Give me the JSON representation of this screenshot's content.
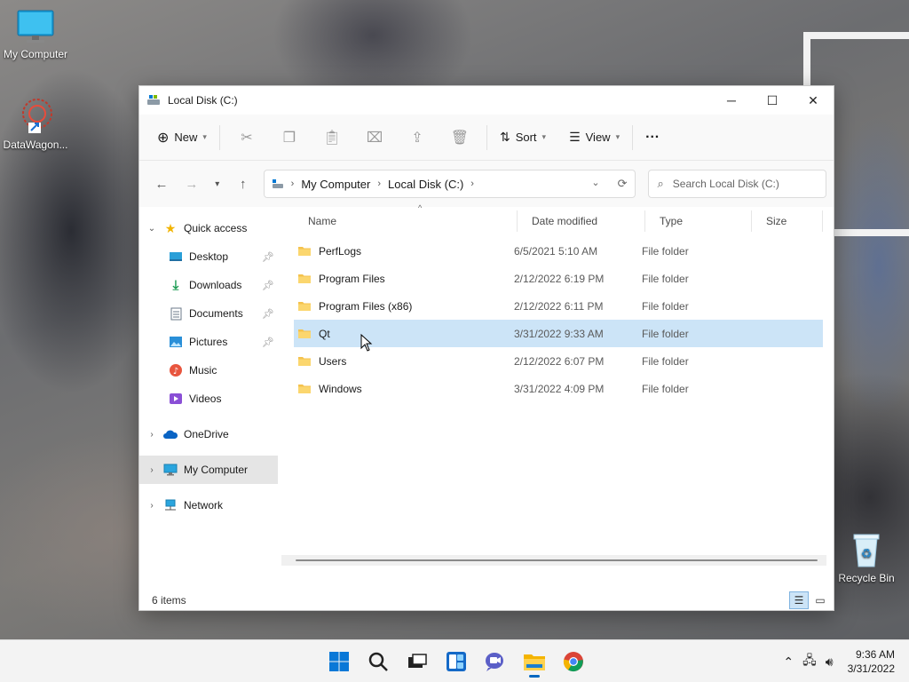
{
  "desktop": {
    "icons": [
      {
        "label": "My Computer"
      },
      {
        "label": "DataWagon..."
      },
      {
        "label": "Recycle Bin"
      }
    ]
  },
  "window": {
    "title": "Local Disk (C:)",
    "controls": {
      "minimize": "─",
      "maximize": "☐",
      "close": "✕"
    }
  },
  "toolbar": {
    "new_label": "New",
    "sort_label": "Sort",
    "view_label": "View",
    "more_label": "···"
  },
  "address": {
    "crumbs": [
      "My Computer",
      "Local Disk (C:)"
    ],
    "search_placeholder": "Search Local Disk (C:)"
  },
  "nav_pane": {
    "quick_access": "Quick access",
    "items": [
      {
        "label": "Desktop",
        "pinned": true
      },
      {
        "label": "Downloads",
        "pinned": true
      },
      {
        "label": "Documents",
        "pinned": true
      },
      {
        "label": "Pictures",
        "pinned": true
      },
      {
        "label": "Music",
        "pinned": false
      },
      {
        "label": "Videos",
        "pinned": false
      }
    ],
    "onedrive": "OneDrive",
    "my_computer": "My Computer",
    "network": "Network"
  },
  "columns": {
    "name": "Name",
    "date": "Date modified",
    "type": "Type",
    "size": "Size"
  },
  "files": [
    {
      "name": "PerfLogs",
      "date": "6/5/2021 5:10 AM",
      "type": "File folder"
    },
    {
      "name": "Program Files",
      "date": "2/12/2022 6:19 PM",
      "type": "File folder"
    },
    {
      "name": "Program Files (x86)",
      "date": "2/12/2022 6:11 PM",
      "type": "File folder"
    },
    {
      "name": "Qt",
      "date": "3/31/2022 9:33 AM",
      "type": "File folder"
    },
    {
      "name": "Users",
      "date": "2/12/2022 6:07 PM",
      "type": "File folder"
    },
    {
      "name": "Windows",
      "date": "3/31/2022 4:09 PM",
      "type": "File folder"
    }
  ],
  "status": {
    "item_count": "6 items"
  },
  "taskbar": {
    "time": "9:36 AM",
    "date": "3/31/2022"
  },
  "colors": {
    "accent": "#0067c0",
    "hover_row": "#cce4f7",
    "folder": "#f4c24d"
  }
}
